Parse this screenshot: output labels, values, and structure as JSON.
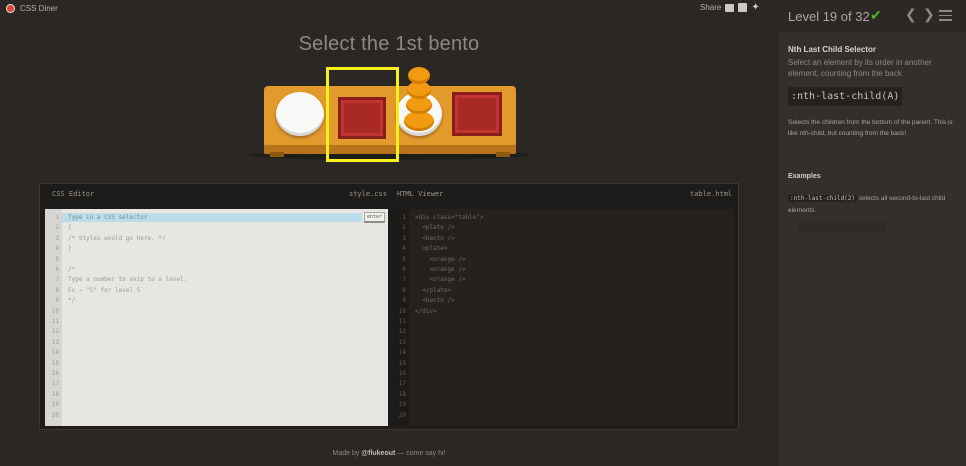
{
  "app": {
    "name": "CSS Diner"
  },
  "share": {
    "label": "Share"
  },
  "instruction": "Select the 1st bento",
  "level": {
    "text": "Level 19 of 32",
    "completed": true
  },
  "selector_info": {
    "title": "Nth Last Child Selector",
    "description": "Select an element by its order in another element, counting from the back",
    "syntax": ":nth-last-child(A)",
    "help": "Selects the children from the bottom of the parent. This is like nth-child, but counting from the back!",
    "examples_title": "Examples",
    "example_code": ":nth-last-child(2)",
    "example_text": " selects all second-to-last child elements."
  },
  "css_editor": {
    "title": "CSS Editor",
    "file": "style.css",
    "input_placeholder": "Type in a CSS selector",
    "enter_label": "enter",
    "lines": [
      "",
      "{",
      "/* Styles would go here. */",
      "}",
      "",
      "/*",
      "Type a number to skip to a level.",
      "Ex → \"5\" for level 5",
      "*/",
      "",
      "",
      "",
      "",
      "",
      "",
      "",
      "",
      "",
      "",
      ""
    ],
    "line_numbers": [
      "1",
      "2",
      "3",
      "4",
      "5",
      "6",
      "7",
      "8",
      "9",
      "10",
      "11",
      "12",
      "13",
      "14",
      "15",
      "16",
      "17",
      "18",
      "19",
      "20"
    ]
  },
  "html_viewer": {
    "title": "HTML Viewer",
    "file": "table.html",
    "lines": [
      "<div class=\"table\">",
      "  <plate />",
      "  <bento />",
      "  <plate>",
      "    <orange />",
      "    <orange />",
      "    <orange />",
      "  </plate>",
      "  <bento />",
      "</div>",
      "",
      "",
      "",
      "",
      "",
      "",
      "",
      "",
      "",
      ""
    ],
    "line_numbers": [
      "1",
      "2",
      "3",
      "4",
      "5",
      "6",
      "7",
      "8",
      "9",
      "10",
      "11",
      "12",
      "13",
      "14",
      "15",
      "16",
      "17",
      "18",
      "19",
      "20"
    ]
  },
  "footer": {
    "prefix": "Made by ",
    "author": "@flukeout",
    "suffix": " — come say hi!"
  },
  "icons": [
    "logo-icon",
    "mail-icon",
    "facebook-icon",
    "twitter-icon",
    "checkmark-icon",
    "chevron-left-icon",
    "chevron-right-icon",
    "menu-icon"
  ],
  "colors": {
    "accent": "#4cbb17",
    "selection": "#f7f01a",
    "table": "#e39a2c",
    "bento": "#a82a26",
    "orange": "#f29a11"
  }
}
